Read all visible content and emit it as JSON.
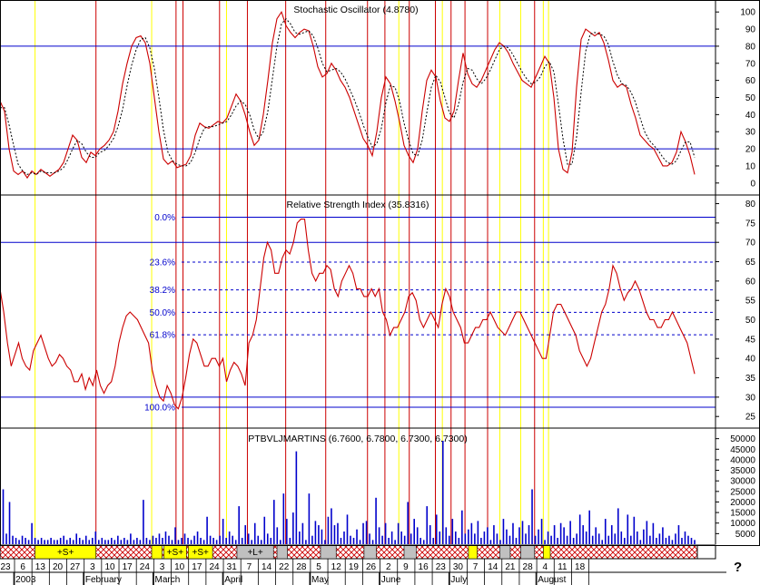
{
  "help_glyph": "?",
  "chart_data": {
    "type": "line",
    "x_ticks": {
      "days": [
        "23",
        "6",
        "13",
        "20",
        "27",
        "3",
        "10",
        "17",
        "24",
        "3",
        "10",
        "17",
        "24",
        "31",
        "7",
        "14",
        "22",
        "28",
        "5",
        "12",
        "19",
        "26",
        "2",
        "9",
        "16",
        "23",
        "30",
        "7",
        "14",
        "21",
        "28",
        "4",
        "11",
        "18"
      ],
      "months": [
        {
          "label": "2003",
          "tick_index": 1
        },
        {
          "label": "February",
          "tick_index": 5
        },
        {
          "label": "March",
          "tick_index": 9
        },
        {
          "label": "April",
          "tick_index": 13
        },
        {
          "label": "May",
          "tick_index": 18
        },
        {
          "label": "June",
          "tick_index": 22
        },
        {
          "label": "July",
          "tick_index": 26
        },
        {
          "label": "August",
          "tick_index": 31
        }
      ]
    },
    "panels": [
      {
        "id": "stochastic",
        "title": "Stochastic Oscillator (4.8780)",
        "ylim": [
          -7,
          107
        ],
        "ticks": [
          100,
          90,
          80,
          70,
          60,
          50,
          40,
          30,
          20,
          10,
          0
        ],
        "levels": [
          80,
          20
        ],
        "series": [
          {
            "name": "%K",
            "style": "solid",
            "color": "#cc0000",
            "values": [
              48,
              42,
              20,
              7,
              5,
              7,
              3,
              7,
              5,
              8,
              6,
              4,
              6,
              8,
              12,
              20,
              28,
              25,
              15,
              12,
              18,
              16,
              20,
              22,
              25,
              30,
              42,
              58,
              70,
              80,
              85,
              86,
              82,
              70,
              50,
              30,
              14,
              11,
              13,
              9,
              10,
              11,
              16,
              28,
              35,
              33,
              32,
              34,
              36,
              35,
              38,
              45,
              52,
              48,
              40,
              30,
              22,
              25,
              40,
              60,
              82,
              96,
              100,
              92,
              88,
              85,
              88,
              90,
              89,
              80,
              68,
              62,
              64,
              70,
              66,
              60,
              56,
              50,
              42,
              34,
              26,
              22,
              16,
              30,
              50,
              62,
              58,
              48,
              36,
              22,
              16,
              12,
              20,
              42,
              60,
              66,
              62,
              48,
              38,
              36,
              42,
              60,
              76,
              64,
              58,
              56,
              60,
              66,
              72,
              78,
              82,
              80,
              76,
              70,
              65,
              60,
              58,
              56,
              62,
              68,
              74,
              70,
              50,
              20,
              8,
              6,
              18,
              56,
              84,
              90,
              88,
              86,
              88,
              82,
              72,
              60,
              56,
              58,
              56,
              46,
              38,
              28,
              25,
              22,
              20,
              15,
              10,
              10,
              12,
              18,
              30,
              24,
              16,
              5
            ]
          },
          {
            "name": "%D",
            "style": "dashed",
            "color": "#000000",
            "values": [
              44,
              44,
              34,
              22,
              11,
              7,
              5,
              6,
              5,
              7,
              6,
              6,
              6,
              7,
              9,
              14,
              20,
              25,
              23,
              18,
              15,
              15,
              18,
              19,
              22,
              26,
              33,
              43,
              57,
              69,
              78,
              84,
              85,
              79,
              67,
              50,
              31,
              18,
              13,
              11,
              10,
              10,
              12,
              18,
              26,
              32,
              33,
              33,
              34,
              35,
              36,
              40,
              45,
              48,
              46,
              40,
              31,
              26,
              30,
              42,
              61,
              80,
              93,
              96,
              93,
              88,
              87,
              88,
              89,
              86,
              79,
              70,
              65,
              66,
              67,
              65,
              61,
              55,
              49,
              42,
              34,
              27,
              21,
              23,
              32,
              47,
              57,
              56,
              48,
              35,
              25,
              17,
              16,
              25,
              41,
              56,
              63,
              59,
              50,
              41,
              38,
              46,
              59,
              67,
              66,
              61,
              58,
              61,
              66,
              72,
              78,
              80,
              79,
              75,
              70,
              65,
              61,
              58,
              59,
              62,
              68,
              71,
              65,
              46,
              26,
              11,
              11,
              27,
              53,
              77,
              87,
              88,
              87,
              86,
              81,
              71,
              63,
              58,
              57,
              53,
              47,
              38,
              30,
              25,
              22,
              19,
              15,
              12,
              11,
              13,
              19,
              24,
              24,
              15
            ]
          }
        ]
      },
      {
        "id": "rsi",
        "title": "Relative Strength Index (35.8316)",
        "ylim": [
          22,
          82
        ],
        "ticks": [
          80,
          75,
          70,
          65,
          60,
          55,
          50,
          45,
          40,
          35,
          30,
          25
        ],
        "levels": [
          70,
          30
        ],
        "fibonacci": [
          {
            "label": "0.0%",
            "value": 76.5
          },
          {
            "label": "23.6%",
            "value": 64.9
          },
          {
            "label": "38.2%",
            "value": 57.7
          },
          {
            "label": "50.0%",
            "value": 51.9
          },
          {
            "label": "61.8%",
            "value": 46.1
          },
          {
            "label": "100.0%",
            "value": 27.4
          }
        ],
        "series": [
          {
            "name": "RSI",
            "style": "solid",
            "color": "#cc0000",
            "values": [
              58,
              52,
              44,
              38,
              41,
              44,
              40,
              38,
              37,
              42,
              44,
              46,
              43,
              40,
              38,
              39,
              41,
              40,
              38,
              37,
              34,
              34,
              36,
              32,
              35,
              33,
              37,
              33,
              31,
              33,
              34,
              38,
              44,
              48,
              51,
              52,
              51,
              50,
              48,
              46,
              44,
              37,
              33,
              30,
              29,
              33,
              31,
              28,
              27,
              30,
              35,
              41,
              45,
              44,
              41,
              38,
              38,
              40,
              40,
              38,
              40,
              34,
              37,
              39,
              38,
              36,
              33,
              44,
              46,
              50,
              58,
              66,
              70,
              68,
              62,
              62,
              66,
              68,
              67,
              70,
              75,
              76,
              76,
              68,
              62,
              60,
              62,
              62,
              64,
              63,
              58,
              56,
              60,
              62,
              64,
              62,
              58,
              58,
              56,
              56,
              58,
              56,
              58,
              52,
              50,
              46,
              48,
              48,
              50,
              52,
              56,
              57,
              55,
              50,
              48,
              50,
              52,
              50,
              48,
              54,
              58,
              56,
              52,
              50,
              48,
              44,
              44,
              46,
              48,
              48,
              50,
              50,
              52,
              50,
              48,
              47,
              46,
              48,
              50,
              52,
              52,
              50,
              48,
              46,
              44,
              42,
              40,
              40,
              46,
              52,
              54,
              54,
              52,
              50,
              48,
              46,
              42,
              40,
              38,
              40,
              44,
              48,
              52,
              54,
              58,
              64,
              62,
              58,
              55,
              57,
              58,
              60,
              58,
              55,
              52,
              50,
              50,
              48,
              48,
              50,
              50,
              52,
              50,
              48,
              46,
              44,
              40,
              36
            ]
          }
        ]
      },
      {
        "id": "volume",
        "title": "PTBVLJMARTINS (6.7600, 6.7800, 6.7300, 6.7300)",
        "ylim": [
          0,
          52000
        ],
        "ticks": [
          50000,
          45000,
          40000,
          35000,
          30000,
          25000,
          20000,
          15000,
          10000,
          5000
        ],
        "series": [
          {
            "name": "Volume",
            "style": "bars",
            "color": "#0000cc",
            "values": [
              8000,
              26000,
              5000,
              20000,
              4000,
              3000,
              2000,
              4000,
              3000,
              2000,
              10000,
              3000,
              2000,
              3000,
              2000,
              2000,
              3000,
              2000,
              2000,
              3000,
              4000,
              2000,
              3000,
              2000,
              5000,
              3000,
              2000,
              4000,
              2000,
              3000,
              6000,
              2000,
              3000,
              2000,
              2000,
              3000,
              2000,
              4000,
              2000,
              3000,
              2000,
              5000,
              2000,
              3000,
              2000,
              21000,
              3000,
              2000,
              4000,
              3000,
              5000,
              3000,
              6000,
              4000,
              2000,
              8000,
              2000,
              3000,
              5000,
              3000,
              2000,
              4000,
              6000,
              3000,
              2000,
              13000,
              4000,
              3000,
              2000,
              4000,
              12000,
              3000,
              6000,
              4000,
              2000,
              18000,
              3000,
              9000,
              5000,
              2000,
              10000,
              4000,
              2000,
              13000,
              5000,
              3000,
              21000,
              8000,
              2000,
              24000,
              12000,
              3000,
              15000,
              44000,
              6000,
              10000,
              2000,
              24000,
              4000,
              11000,
              9000,
              7000,
              2000,
              13000,
              17000,
              9000,
              10000,
              3000,
              6000,
              14000,
              4000,
              3000,
              7000,
              2000,
              10000,
              11000,
              5000,
              2000,
              22000,
              8000,
              4000,
              10000,
              3000,
              6000,
              2000,
              10000,
              6000,
              4000,
              20000,
              5000,
              12000,
              8000,
              3000,
              2000,
              18000,
              9000,
              3000,
              14000,
              6000,
              49000,
              8000,
              4000,
              12000,
              6000,
              3000,
              16000,
              5000,
              7000,
              10000,
              5000,
              11000,
              3000,
              6000,
              8000,
              2000,
              9000,
              5000,
              2000,
              12000,
              7000,
              4000,
              10000,
              3000,
              8000,
              11000,
              5000,
              9000,
              26000,
              4000,
              7000,
              12000,
              2000,
              6000,
              4000,
              9000,
              3000,
              10000,
              8000,
              4000,
              11000,
              3000,
              5000,
              14000,
              9000,
              6000,
              16000,
              4000,
              8000,
              5000,
              2000,
              12000,
              4000,
              9000,
              5000,
              17000,
              6000,
              3000,
              14000,
              4000,
              13000,
              6000,
              2000,
              7000,
              11000,
              4000,
              10000,
              3000,
              5000,
              8000,
              3000,
              4000,
              2000,
              5000,
              9000,
              3000,
              6000,
              4000,
              3000,
              2000
            ]
          }
        ]
      }
    ],
    "vertical_lines": {
      "red_ticks": [
        5.2,
        9.8,
        10.2,
        12.3,
        13.9,
        16.1,
        18.4,
        20.8,
        21.8,
        23.2,
        24.7,
        25.6,
        26.4,
        27.7,
        30.4
      ],
      "yellow_ticks": [
        1.7,
        8.4,
        12.7,
        22.6,
        25.1,
        28.4,
        29.6,
        30.9,
        31.2
      ]
    },
    "signal_bands": [
      {
        "label": "+S+",
        "from": 1.7,
        "to": 5.2,
        "color": "#ffff00"
      },
      {
        "label": "",
        "from": 8.4,
        "to": 9.0,
        "color": "#ffff00"
      },
      {
        "label": "+S+",
        "from": 9.1,
        "to": 10.4,
        "color": "#ffff00"
      },
      {
        "label": "+S+",
        "from": 10.5,
        "to": 11.9,
        "color": "#ffff00"
      },
      {
        "label": "+L+",
        "from": 13.3,
        "to": 15.4,
        "color": "#c0c0c0"
      },
      {
        "label": "",
        "from": 15.6,
        "to": 16.2,
        "color": "#c0c0c0"
      },
      {
        "label": "",
        "from": 18.1,
        "to": 19.0,
        "color": "#c0c0c0"
      },
      {
        "label": "",
        "from": 20.6,
        "to": 21.3,
        "color": "#c0c0c0"
      },
      {
        "label": "",
        "from": 22.9,
        "to": 23.6,
        "color": "#c0c0c0"
      },
      {
        "label": "",
        "from": 26.6,
        "to": 27.1,
        "color": "#ffff00"
      },
      {
        "label": "",
        "from": 28.4,
        "to": 29.0,
        "color": "#c0c0c0"
      },
      {
        "label": "",
        "from": 29.6,
        "to": 30.4,
        "color": "#c0c0c0"
      },
      {
        "label": "",
        "from": 30.9,
        "to": 31.3,
        "color": "#ffff00"
      }
    ],
    "colors": {
      "price_line": "#cc0000",
      "level_line": "#0000cc",
      "red_vertical": "#cc0000",
      "yellow_vertical": "#ffff00",
      "hatch": "#cc0000"
    }
  }
}
